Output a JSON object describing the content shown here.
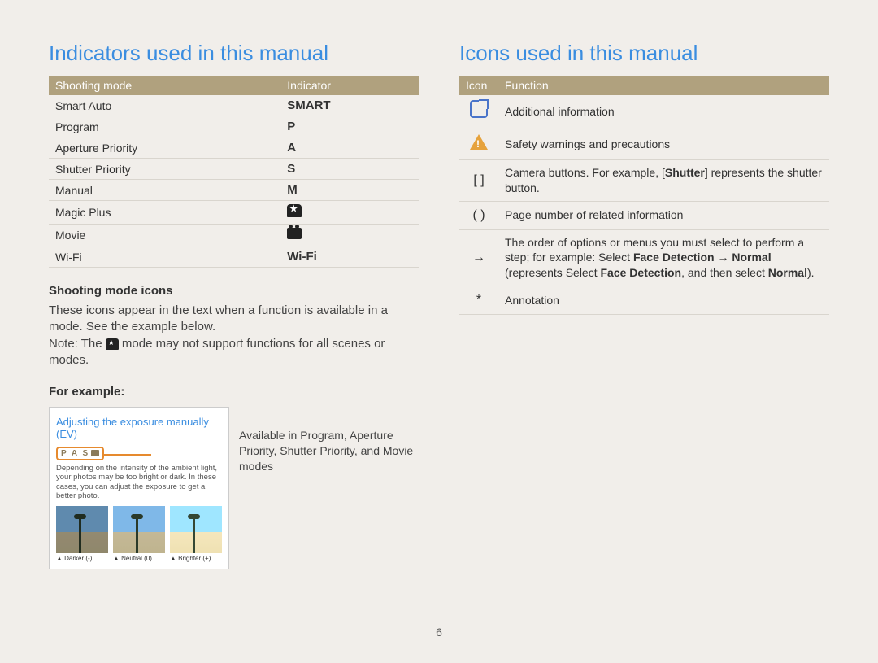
{
  "page_number": "6",
  "left": {
    "heading": "Indicators used in this manual",
    "table": {
      "col1": "Shooting mode",
      "col2": "Indicator",
      "rows": [
        {
          "mode": "Smart Auto",
          "indicator": "SMART",
          "type": "text"
        },
        {
          "mode": "Program",
          "indicator": "P",
          "type": "text"
        },
        {
          "mode": "Aperture Priority",
          "indicator": "A",
          "type": "text"
        },
        {
          "mode": "Shutter Priority",
          "indicator": "S",
          "type": "text"
        },
        {
          "mode": "Manual",
          "indicator": "M",
          "type": "text"
        },
        {
          "mode": "Magic Plus",
          "indicator": "",
          "type": "icon-star"
        },
        {
          "mode": "Movie",
          "indicator": "",
          "type": "icon-movie"
        },
        {
          "mode": "Wi-Fi",
          "indicator": "Wi-Fi",
          "type": "text"
        }
      ]
    },
    "sub1_title": "Shooting mode icons",
    "sub1_p1": "These icons appear in the text when a function is available in a mode. See the example below.",
    "sub1_note_pre": "Note: The ",
    "sub1_note_post": " mode may not support functions for all scenes or modes.",
    "sub2_title": "For example:",
    "example": {
      "title": "Adjusting the exposure manually (EV)",
      "badge": "P A S",
      "desc": "Depending on the intensity of the ambient light, your photos may be too bright or dark. In these cases, you can adjust the exposure to get a better photo.",
      "thumbs": [
        {
          "label": "Darker (-)",
          "cls": "dark"
        },
        {
          "label": "Neutral (0)",
          "cls": ""
        },
        {
          "label": "Brighter (+)",
          "cls": "bright"
        }
      ]
    },
    "callout": "Available in Program, Aperture Priority, Shutter Priority, and Movie modes"
  },
  "right": {
    "heading": "Icons used in this manual",
    "table": {
      "col1": "Icon",
      "col2": "Function",
      "rows": [
        {
          "icon": "info",
          "func_plain": "Additional information"
        },
        {
          "icon": "warn",
          "func_plain": "Safety warnings and precautions"
        },
        {
          "icon": "[ ]",
          "func_html": "Camera buttons. For example, [<b>Shutter</b>] represents the shutter button."
        },
        {
          "icon": "( )",
          "func_plain": "Page number of related information"
        },
        {
          "icon": "→",
          "func_html": "The order of options or menus you must select to perform a step; for example: Select <b>Face Detection</b> → <b>Normal</b> (represents Select <b>Face Detection</b>, and then select <b>Normal</b>)."
        },
        {
          "icon": "*",
          "func_plain": "Annotation"
        }
      ]
    }
  }
}
